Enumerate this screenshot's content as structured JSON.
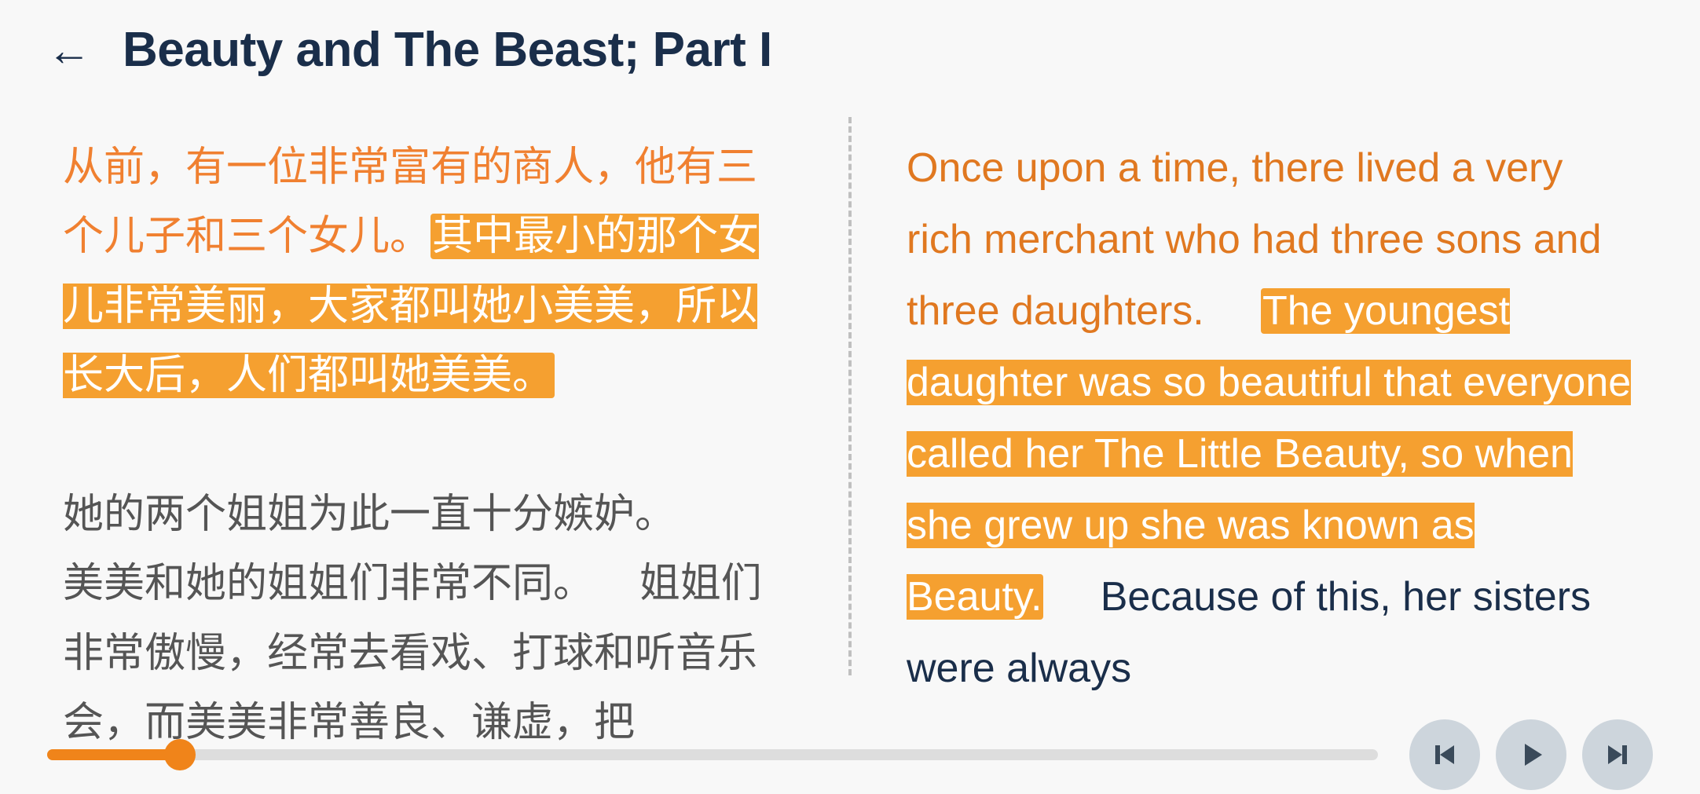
{
  "header": {
    "back_label": "←",
    "title": "Beauty and The Beast; Part I"
  },
  "left_panel": {
    "text_segments": [
      {
        "text": "从前，有一位非常富有的商人，他有三个儿子和三个女儿。",
        "highlight": false
      },
      {
        "text": "其中最小的那个女儿非常美丽，大家都叫她小美美，所以长大后，人们都叫她美美。",
        "highlight": true
      },
      {
        "text": "她的两个姐姐为此一直十分嫉妒。美美和她的姐姐们非常不同。  姐姐们非常傲慢，经常去看戏、打球和听音乐会，而美美非常善良、谦虚，把",
        "highlight": false
      }
    ]
  },
  "right_panel": {
    "text_segments": [
      {
        "text": "Once upon a time, there lived a very rich merchant who had three sons and three daughters.",
        "highlight": false
      },
      {
        "text": "The youngest daughter was so beautiful that everyone called her The Little Beauty, so when she grew up she was known as Beauty.",
        "highlight": true
      },
      {
        "text": "Because of this, her sisters were always",
        "highlight": false
      }
    ]
  },
  "playback": {
    "progress_percent": 10,
    "back_label": "⏮",
    "play_label": "▶",
    "forward_label": "⏭"
  },
  "icons": {
    "back_arrow": "←",
    "prev_icon": "prev",
    "play_icon": "play",
    "next_icon": "next"
  }
}
